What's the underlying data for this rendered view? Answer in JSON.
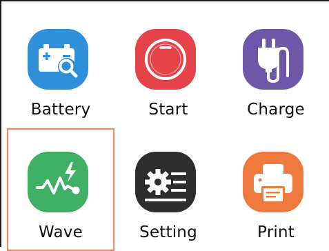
{
  "tiles": [
    {
      "label": "Battery",
      "icon": "battery-search-icon",
      "color": "#2f8fd9"
    },
    {
      "label": "Start",
      "icon": "start-circle-icon",
      "color": "#e5434a"
    },
    {
      "label": "Charge",
      "icon": "plug-icon",
      "color": "#6d57a8"
    },
    {
      "label": "Wave",
      "icon": "waveform-lightning-icon",
      "color": "#3fb064",
      "selected": true
    },
    {
      "label": "Setting",
      "icon": "gear-list-icon",
      "color": "#2d2d2d"
    },
    {
      "label": "Print",
      "icon": "printer-icon",
      "color": "#ee7a3f"
    }
  ],
  "selection_border_color": "#e98a5f"
}
